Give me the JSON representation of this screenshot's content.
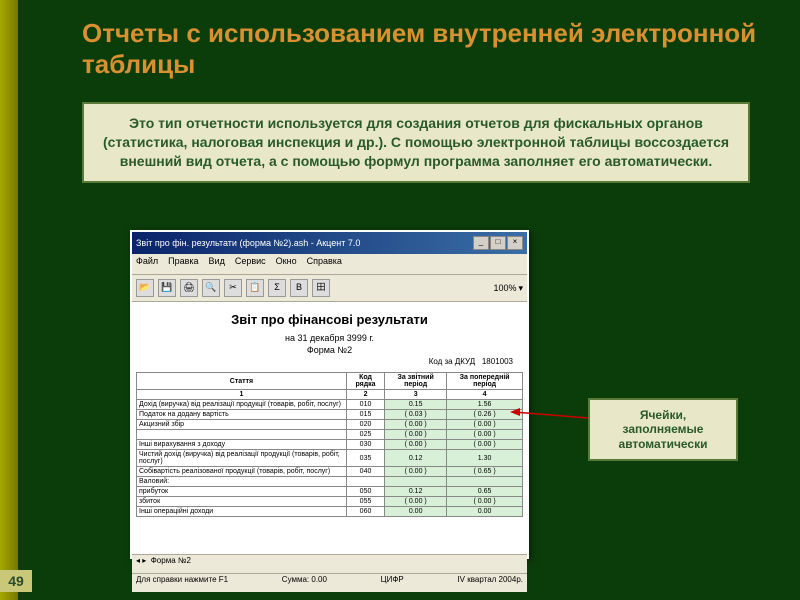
{
  "slide": {
    "title": "Отчеты с использованием внутренней электронной таблицы",
    "page_number": "49"
  },
  "info": {
    "text": "Это тип отчетности используется для создания отчетов для фискальных органов (статистика, налоговая инспекция и др.). С помощью электронной таблицы воссоздается внешний вид отчета, а с помощью формул программа заполняет его автоматически."
  },
  "callout": {
    "text": "Ячейки, заполняемые автоматически"
  },
  "window": {
    "title": "Звіт про фін. результати (форма №2).ash - Акцент 7.0",
    "menu": [
      "Файл",
      "Правка",
      "Вид",
      "Сервис",
      "Окно",
      "Справка"
    ],
    "zoom": "100%",
    "doc_title": "Звіт про фінансові результати",
    "date_line": "на 31 декабря 3999 г.",
    "form_line": "Форма №2",
    "code_label": "Код за ДКУД",
    "code_value": "1801003",
    "tab_name": "Форма №2",
    "status_help": "Для справки нажмите F1",
    "status_sum": "Сумма: 0.00",
    "status_mode": "ЦИФР",
    "status_period": "IV квартал 2004р.",
    "table": {
      "headers": [
        "Стаття",
        "Код рядка",
        "За звітний період",
        "За попередній період"
      ],
      "subheaders": [
        "1",
        "2",
        "3",
        "4"
      ],
      "rows": [
        {
          "name": "Дохід (виручка) від реалізації продукції (товарів, робіт, послуг)",
          "code": "010",
          "cur": "0.15",
          "prev": "1.56"
        },
        {
          "name": "Податок на додану вартість",
          "code": "015",
          "cur": "( 0.03 )",
          "prev": "( 0.26 )"
        },
        {
          "name": "Акцизний збір",
          "code": "020",
          "cur": "( 0.00 )",
          "prev": "( 0.00 )"
        },
        {
          "name": "",
          "code": "025",
          "cur": "( 0.00 )",
          "prev": "( 0.00 )"
        },
        {
          "name": "Інші вирахування з доходу",
          "code": "030",
          "cur": "( 0.00 )",
          "prev": "( 0.00 )"
        },
        {
          "name": "Чистий дохід (виручка) від реалізації продукції (товарів, робіт, послуг)",
          "code": "035",
          "cur": "0.12",
          "prev": "1.30"
        },
        {
          "name": "Собівартість реалізованої продукції (товарів, робіт, послуг)",
          "code": "040",
          "cur": "( 0.00 )",
          "prev": "( 0.65 )"
        },
        {
          "name": "Валовий:",
          "code": "",
          "cur": "",
          "prev": ""
        },
        {
          "name": "прибуток",
          "code": "050",
          "cur": "0.12",
          "prev": "0.65"
        },
        {
          "name": "збиток",
          "code": "055",
          "cur": "( 0.00 )",
          "prev": "( 0.00 )"
        },
        {
          "name": "Інші операційні доходи",
          "code": "060",
          "cur": "0.00",
          "prev": "0.00"
        }
      ]
    }
  }
}
